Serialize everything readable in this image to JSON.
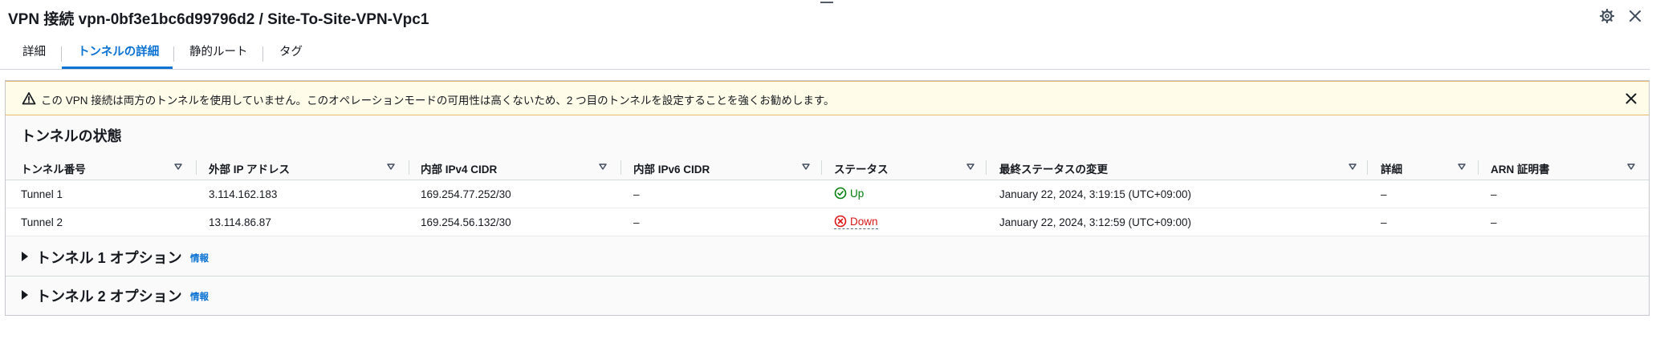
{
  "header": {
    "title": "VPN 接続 vpn-0bf3e1bc6d99796d2 / Site-To-Site-VPN-Vpc1",
    "settings_icon": "gear-icon",
    "close_icon": "close-icon"
  },
  "tabs": [
    {
      "label": "詳細",
      "active": false
    },
    {
      "label": "トンネルの詳細",
      "active": true
    },
    {
      "label": "静的ルート",
      "active": false
    },
    {
      "label": "タグ",
      "active": false
    }
  ],
  "alert": {
    "type": "warning",
    "text": "この VPN 接続は両方のトンネルを使用していません。このオペレーションモードの可用性は高くないため、2 つ目のトンネルを設定することを強くお勧めします。"
  },
  "tunnel_status": {
    "title": "トンネルの状態",
    "columns": [
      "トンネル番号",
      "外部 IP アドレス",
      "内部 IPv4 CIDR",
      "内部 IPv6 CIDR",
      "ステータス",
      "最終ステータスの変更",
      "詳細",
      "ARN 証明書"
    ],
    "rows": [
      {
        "tunnel": "Tunnel 1",
        "outside_ip": "3.114.162.183",
        "inside_ipv4": "169.254.77.252/30",
        "inside_ipv6": "–",
        "status": "Up",
        "last_change": "January 22, 2024, 3:19:15 (UTC+09:00)",
        "details": "–",
        "arn": "–"
      },
      {
        "tunnel": "Tunnel 2",
        "outside_ip": "13.114.86.87",
        "inside_ipv4": "169.254.56.132/30",
        "inside_ipv6": "–",
        "status": "Down",
        "last_change": "January 22, 2024, 3:12:59 (UTC+09:00)",
        "details": "–",
        "arn": "–"
      }
    ]
  },
  "expanders": [
    {
      "title": "トンネル 1 オプション",
      "info": "情報"
    },
    {
      "title": "トンネル 2 オプション",
      "info": "情報"
    }
  ],
  "colors": {
    "accent": "#0972d3",
    "success": "#037f0c",
    "error": "#d91515",
    "warning_bg": "#fffce9"
  }
}
